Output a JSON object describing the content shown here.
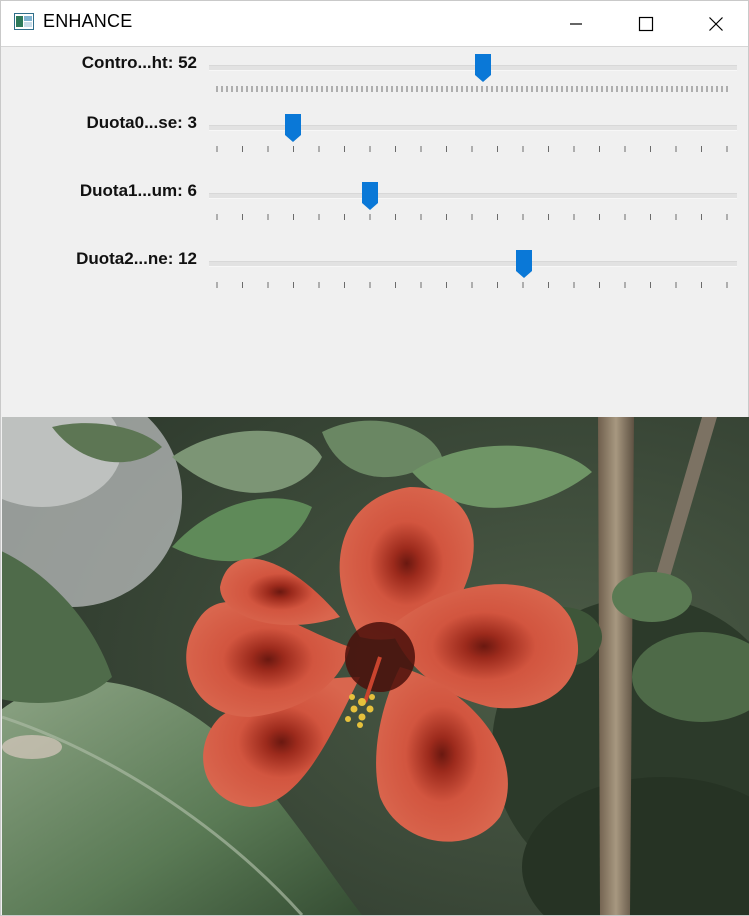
{
  "window": {
    "title": "ENHANCE"
  },
  "trackbars": [
    {
      "label": "Contro...ht: 52",
      "value": 52,
      "fraction": 0.518
    },
    {
      "label": "Duota0...se: 3",
      "value": 3,
      "fraction": 0.16
    },
    {
      "label": "Duota1...um: 6",
      "value": 6,
      "fraction": 0.305
    },
    {
      "label": "Duota2...ne: 12",
      "value": 12,
      "fraction": 0.597
    }
  ],
  "icons": {
    "app": "window-app-icon",
    "minimize": "minimize-icon",
    "maximize": "maximize-icon",
    "close": "close-icon"
  },
  "colors": {
    "thumb": "#0a78d7",
    "panel_bg": "#f0f0f0",
    "track": "#e2e2e2"
  },
  "image": {
    "subject": "red-hibiscus-flower"
  }
}
